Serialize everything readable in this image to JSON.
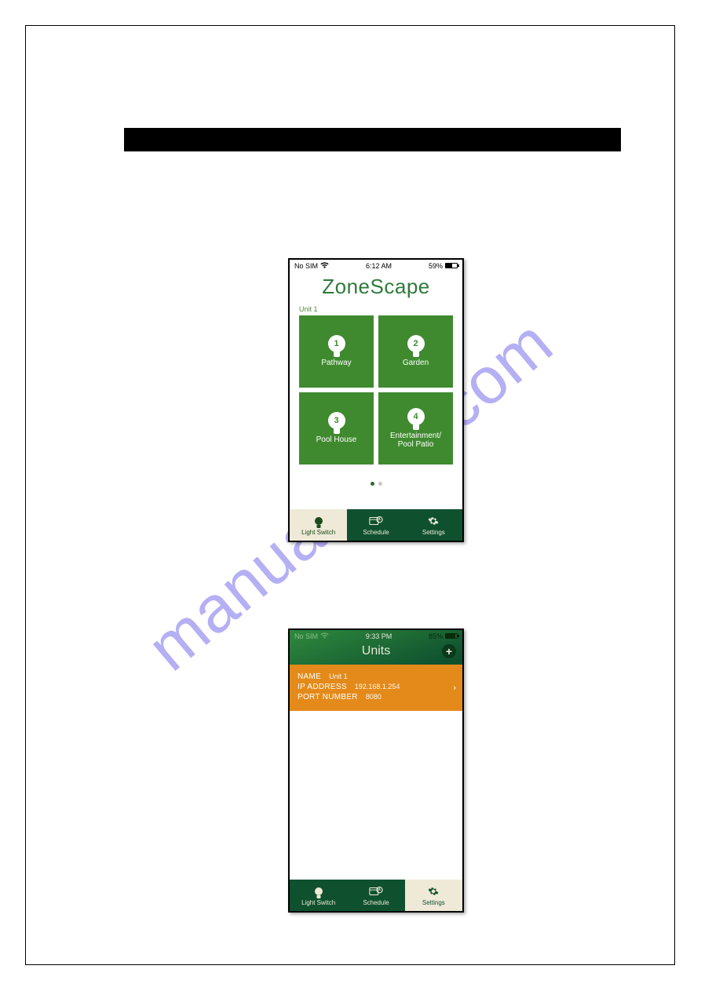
{
  "watermark": "manualslive.com",
  "phoneA": {
    "status": {
      "carrier": "No SIM",
      "time": "6:12 AM",
      "battery_text": "59%",
      "battery_fill": 59
    },
    "app_title": "ZoneScape",
    "unit_label": "Unit 1",
    "tiles": [
      {
        "num": "1",
        "label": "Pathway"
      },
      {
        "num": "2",
        "label": "Garden"
      },
      {
        "num": "3",
        "label": "Pool House"
      },
      {
        "num": "4",
        "label": "Entertainment/\nPool Patio"
      }
    ],
    "tabs": {
      "light": "Light Switch",
      "schedule": "Schedule",
      "settings": "Settings"
    }
  },
  "phoneB": {
    "status": {
      "carrier": "No SIM",
      "time": "9:33 PM",
      "battery_text": "85%",
      "battery_fill": 85
    },
    "header_title": "Units",
    "unit": {
      "name_label": "NAME",
      "name_value": "Unit 1",
      "ip_label": "IP ADDRESS",
      "ip_value": "192.168.1.254",
      "port_label": "PORT NUMBER",
      "port_value": "8080"
    },
    "tabs": {
      "light": "Light Switch",
      "schedule": "Schedule",
      "settings": "Settings"
    }
  }
}
